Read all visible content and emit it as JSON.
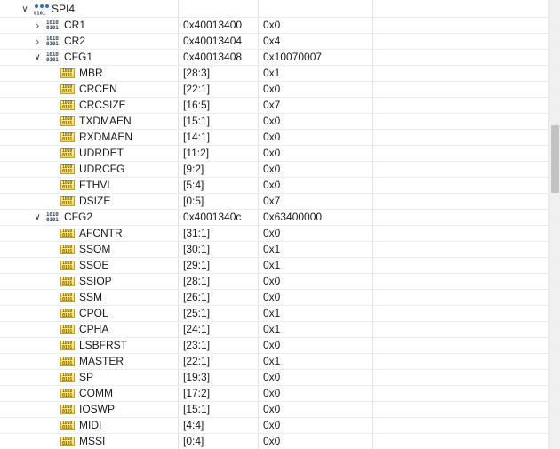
{
  "rows": [
    {
      "kind": "peripheral",
      "depth": 0,
      "expand": "open",
      "icon": "peripheral-group-icon",
      "name": "SPI4",
      "address": "",
      "value": ""
    },
    {
      "kind": "register",
      "depth": 1,
      "expand": "closed",
      "icon": "register-bits-icon",
      "name": "CR1",
      "address": "0x40013400",
      "value": "0x0"
    },
    {
      "kind": "register",
      "depth": 1,
      "expand": "closed",
      "icon": "register-bits-icon",
      "name": "CR2",
      "address": "0x40013404",
      "value": "0x4"
    },
    {
      "kind": "register",
      "depth": 1,
      "expand": "open",
      "icon": "register-bits-icon",
      "name": "CFG1",
      "address": "0x40013408",
      "value": "0x10070007"
    },
    {
      "kind": "field",
      "depth": 2,
      "expand": "none",
      "icon": "field-bits-icon",
      "name": "MBR",
      "address": "[28:3]",
      "value": "0x1"
    },
    {
      "kind": "field",
      "depth": 2,
      "expand": "none",
      "icon": "field-bits-icon",
      "name": "CRCEN",
      "address": "[22:1]",
      "value": "0x0"
    },
    {
      "kind": "field",
      "depth": 2,
      "expand": "none",
      "icon": "field-bits-icon",
      "name": "CRCSIZE",
      "address": "[16:5]",
      "value": "0x7"
    },
    {
      "kind": "field",
      "depth": 2,
      "expand": "none",
      "icon": "field-bits-icon",
      "name": "TXDMAEN",
      "address": "[15:1]",
      "value": "0x0"
    },
    {
      "kind": "field",
      "depth": 2,
      "expand": "none",
      "icon": "field-bits-icon",
      "name": "RXDMAEN",
      "address": "[14:1]",
      "value": "0x0"
    },
    {
      "kind": "field",
      "depth": 2,
      "expand": "none",
      "icon": "field-bits-icon",
      "name": "UDRDET",
      "address": "[11:2]",
      "value": "0x0"
    },
    {
      "kind": "field",
      "depth": 2,
      "expand": "none",
      "icon": "field-bits-icon",
      "name": "UDRCFG",
      "address": "[9:2]",
      "value": "0x0"
    },
    {
      "kind": "field",
      "depth": 2,
      "expand": "none",
      "icon": "field-bits-icon",
      "name": "FTHVL",
      "address": "[5:4]",
      "value": "0x0"
    },
    {
      "kind": "field",
      "depth": 2,
      "expand": "none",
      "icon": "field-bits-icon",
      "name": "DSIZE",
      "address": "[0:5]",
      "value": "0x7"
    },
    {
      "kind": "register",
      "depth": 1,
      "expand": "open",
      "icon": "register-bits-icon",
      "name": "CFG2",
      "address": "0x4001340c",
      "value": "0x63400000"
    },
    {
      "kind": "field",
      "depth": 2,
      "expand": "none",
      "icon": "field-bits-icon",
      "name": "AFCNTR",
      "address": "[31:1]",
      "value": "0x0"
    },
    {
      "kind": "field",
      "depth": 2,
      "expand": "none",
      "icon": "field-bits-icon",
      "name": "SSOM",
      "address": "[30:1]",
      "value": "0x1"
    },
    {
      "kind": "field",
      "depth": 2,
      "expand": "none",
      "icon": "field-bits-icon",
      "name": "SSOE",
      "address": "[29:1]",
      "value": "0x1"
    },
    {
      "kind": "field",
      "depth": 2,
      "expand": "none",
      "icon": "field-bits-icon",
      "name": "SSIOP",
      "address": "[28:1]",
      "value": "0x0"
    },
    {
      "kind": "field",
      "depth": 2,
      "expand": "none",
      "icon": "field-bits-icon",
      "name": "SSM",
      "address": "[26:1]",
      "value": "0x0"
    },
    {
      "kind": "field",
      "depth": 2,
      "expand": "none",
      "icon": "field-bits-icon",
      "name": "CPOL",
      "address": "[25:1]",
      "value": "0x1"
    },
    {
      "kind": "field",
      "depth": 2,
      "expand": "none",
      "icon": "field-bits-icon",
      "name": "CPHA",
      "address": "[24:1]",
      "value": "0x1"
    },
    {
      "kind": "field",
      "depth": 2,
      "expand": "none",
      "icon": "field-bits-icon",
      "name": "LSBFRST",
      "address": "[23:1]",
      "value": "0x0"
    },
    {
      "kind": "field",
      "depth": 2,
      "expand": "none",
      "icon": "field-bits-icon",
      "name": "MASTER",
      "address": "[22:1]",
      "value": "0x1"
    },
    {
      "kind": "field",
      "depth": 2,
      "expand": "none",
      "icon": "field-bits-icon",
      "name": "SP",
      "address": "[19:3]",
      "value": "0x0"
    },
    {
      "kind": "field",
      "depth": 2,
      "expand": "none",
      "icon": "field-bits-icon",
      "name": "COMM",
      "address": "[17:2]",
      "value": "0x0"
    },
    {
      "kind": "field",
      "depth": 2,
      "expand": "none",
      "icon": "field-bits-icon",
      "name": "IOSWP",
      "address": "[15:1]",
      "value": "0x0"
    },
    {
      "kind": "field",
      "depth": 2,
      "expand": "none",
      "icon": "field-bits-icon",
      "name": "MIDI",
      "address": "[4:4]",
      "value": "0x0"
    },
    {
      "kind": "field",
      "depth": 2,
      "expand": "none",
      "icon": "field-bits-icon",
      "name": "MSSI",
      "address": "[0:4]",
      "value": "0x0"
    }
  ],
  "scrollbar": {
    "position_fraction": 0.28,
    "visible_fraction": 0.15
  },
  "colors": {
    "field_icon": "#f4d84a",
    "register_icon": "#3a4a5a",
    "gridline": "#ececec"
  }
}
